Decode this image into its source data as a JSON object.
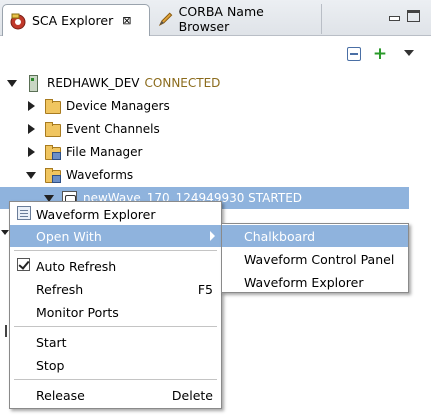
{
  "tabs": [
    {
      "label": "SCA Explorer",
      "icon": "sca-explorer-icon",
      "active": true,
      "close": "⊠"
    },
    {
      "label": "CORBA Name Browser",
      "icon": "corba-icon",
      "active": false
    }
  ],
  "toolbar": {
    "collapse": "collapse-all-icon",
    "add": "+",
    "menu": "view-menu-icon"
  },
  "tree": {
    "domain": {
      "name": "REDHAWK_DEV",
      "status": "CONNECTED",
      "status_color": "#8b6b1c"
    },
    "children": [
      {
        "label": "Device Managers"
      },
      {
        "label": "Event Channels"
      },
      {
        "label": "File Manager"
      },
      {
        "label": "Waveforms"
      }
    ],
    "selected_waveform": "newWave_170_124949930 STARTED"
  },
  "context_menu": {
    "items": {
      "waveform_explorer": "Waveform Explorer",
      "open_with": "Open With",
      "auto_refresh": "Auto Refresh",
      "refresh": "Refresh",
      "refresh_accel": "F5",
      "monitor_ports": "Monitor Ports",
      "start": "Start",
      "stop": "Stop",
      "release": "Release",
      "release_accel": "Delete"
    },
    "auto_refresh_checked": true
  },
  "submenu": {
    "items": [
      "Chalkboard",
      "Waveform Control Panel",
      "Waveform Explorer"
    ],
    "highlighted": "Chalkboard"
  },
  "colors": {
    "selection": "#8fb3dd",
    "add_green": "#2a9a2a"
  }
}
